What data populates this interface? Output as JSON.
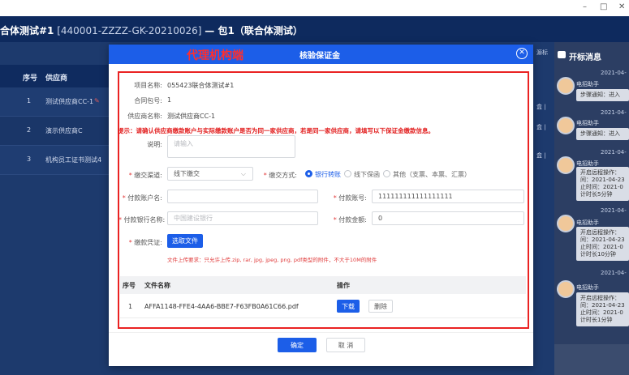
{
  "window": {
    "minimize": "–",
    "maximize": "□",
    "close": "✕"
  },
  "header": {
    "title_main": "合体测试#1",
    "title_code": " [440001-ZZZZ-GK-20210026] ",
    "title_tail": "— 包1（联合体测试）"
  },
  "bg_table": {
    "headers": [
      "序号",
      "供应商"
    ],
    "rows": [
      {
        "index": "1",
        "supplier": "测试供应商CC-1"
      },
      {
        "index": "2",
        "supplier": "演示供应商C"
      },
      {
        "index": "3",
        "supplier": "机构员工证书测试4"
      }
    ],
    "right_cells": [
      "源标",
      "盒 |",
      "盒 |",
      "盒 |"
    ]
  },
  "notice": {
    "title": "开标消息",
    "messages": [
      {
        "time": "2021-04-",
        "from": "电招助手",
        "lines": [
          "步骤通知：进入"
        ]
      },
      {
        "time": "2021-04-",
        "from": "电招助手",
        "lines": [
          "步骤通知：进入"
        ]
      },
      {
        "time": "2021-04-",
        "from": "电招助手",
        "lines": [
          "开启远程操作：",
          "间：2021-04-23",
          "止时间：2021-0",
          "计时长5分钟"
        ]
      },
      {
        "time": "2021-04-",
        "from": "电招助手",
        "lines": [
          "开启远程操作：",
          "间：2021-04-23",
          "止时间：2021-0",
          "计时长10分钟"
        ]
      },
      {
        "time": "2021-04-",
        "from": "电招助手",
        "lines": [
          "开启远程操作：",
          "间：2021-04-23",
          "止时间：2021-0",
          "计时长1分钟"
        ]
      }
    ]
  },
  "modal": {
    "title": "核验保证金",
    "agency_label": "代理机构端",
    "project_name_label": "项目名称:",
    "project_name": "055423联合体测试#1",
    "package_label": "合同包号:",
    "package": "1",
    "supplier_label": "供应商名称:",
    "supplier": "测试供应商CC-1",
    "warning": "提示：请确认供应商缴款账户与实际缴款账户是否为同一家供应商，若是同一家供应商，请填写以下保证金缴款信息。",
    "remark_label": "说明:",
    "remark_placeholder": "请输入",
    "channel_label": "缴交渠道:",
    "channel_value": "线下缴交",
    "method_label": "缴交方式:",
    "methods": [
      {
        "label": "银行转账",
        "selected": true
      },
      {
        "label": "线下保函",
        "selected": false
      },
      {
        "label": "其他（支票、本票、汇票）",
        "selected": false
      }
    ],
    "pay_name_label": "付款账户名:",
    "pay_name_value": "",
    "pay_account_label": "付款账号:",
    "pay_account_value": "111111111111111111",
    "pay_bank_label": "付款银行名称:",
    "pay_bank_placeholder": "中国建设银行",
    "amount_label": "付款金额:",
    "amount_value": "0",
    "voucher_label": "缴款凭证:",
    "select_file": "选取文件",
    "upload_note": "文件上传要求：只允许上传.zip, rar, jpg, jpeg, png, pdf类型的附件，不大于10M的附件",
    "file_table": {
      "headers": [
        "序号",
        "文件名称",
        "操作"
      ],
      "rows": [
        {
          "index": "1",
          "name": "AFFA1148-FFE4-4AA6-BBE7-F63FB0A61C66.pdf",
          "download": "下载",
          "delete": "删除"
        }
      ]
    },
    "confirm": "确定",
    "cancel": "取 消"
  },
  "colors": {
    "primary": "#1c5ee8",
    "header_bg": "#0e2a5e",
    "warning": "#e21f1f"
  }
}
